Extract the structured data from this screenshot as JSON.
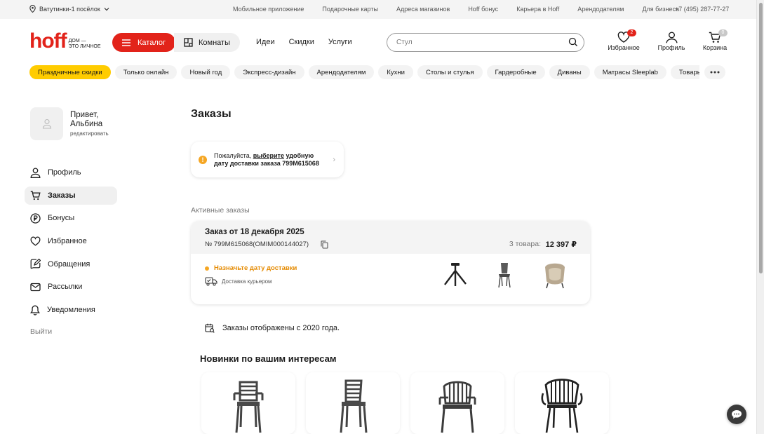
{
  "topbar": {
    "location": "Ватутинки-1 посёлок",
    "links": [
      "Мобильное приложение",
      "Подарочные карты",
      "Адреса магазинов",
      "Hoff бонус",
      "Карьера в Hoff",
      "Арендодателям",
      "Для бизнеса"
    ],
    "phone": "+7 (495) 287-77-27"
  },
  "header": {
    "logo": "hoff",
    "logo_tag_1": "ДОМ —",
    "logo_tag_2": "ЭТО ЛИЧНОЕ",
    "catalog_label": "Каталог",
    "rooms_label": "Комнаты",
    "nav": [
      "Идеи",
      "Скидки",
      "Услуги"
    ],
    "search_placeholder": "Стул",
    "favorites_label": "Избранное",
    "favorites_count": "2",
    "profile_label": "Профиль",
    "cart_label": "Корзина",
    "cart_count": "0",
    "brand_color": "#e2231a"
  },
  "categories": [
    "Праздничные скидки",
    "Только онлайн",
    "Новый год",
    "Экспресс-дизайн",
    "Арендодателям",
    "Кухни",
    "Столы и стулья",
    "Гардеробные",
    "Диваны",
    "Матрасы Sleeplab",
    "Товары для дома"
  ],
  "user": {
    "greeting_1": "Привет,",
    "greeting_2": "Альбина",
    "edit_label": "редактировать"
  },
  "sidebar": {
    "items": [
      {
        "label": "Профиль",
        "icon": "user-icon"
      },
      {
        "label": "Заказы",
        "icon": "cart-icon"
      },
      {
        "label": "Бонусы",
        "icon": "ruble-coin-icon"
      },
      {
        "label": "Избранное",
        "icon": "heart-icon"
      },
      {
        "label": "Обращения",
        "icon": "edit-message-icon"
      },
      {
        "label": "Рассылки",
        "icon": "mail-icon"
      },
      {
        "label": "Уведомления",
        "icon": "bell-icon"
      }
    ],
    "active": "Заказы",
    "logout_label": "Выйти"
  },
  "main": {
    "title": "Заказы",
    "notice": {
      "lead": "Пожалуйста, ",
      "link": "выберите",
      "rest": " удобную дату доставки заказа 799M615068"
    },
    "active_orders_label": "Активные заказы",
    "order": {
      "title": "Заказ от 18 декабря 2025",
      "number": "№ 799M615068(OMIM000144027)",
      "items_count": "3 товара:",
      "price": "12 397 ₽",
      "status": "Назначьте дату доставки",
      "delivery": "Доставка курьером",
      "status_color": "#f5a623"
    },
    "history_note": "Заказы отображены с 2020 года.",
    "recommend_title": "Новинки по вашим интересам"
  }
}
